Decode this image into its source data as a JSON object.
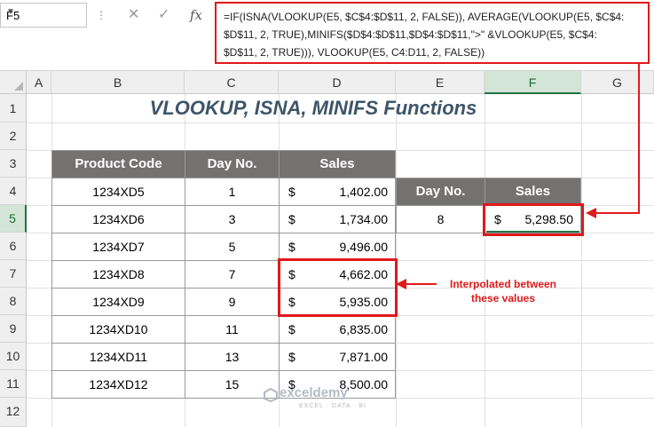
{
  "formula_bar": {
    "name_box": "F5",
    "formula": "=IF(ISNA(VLOOKUP(E5, $C$4:$D$11, 2, FALSE)), AVERAGE(VLOOKUP(E5, $C$4:\n$D$11, 2, TRUE),MINIFS($D$4:$D$11,$D$4:$D$11,\">\" &VLOOKUP(E5, $C$4:\n$D$11, 2, TRUE))), VLOOKUP(E5, C4:D11, 2, FALSE))"
  },
  "columns": [
    "A",
    "B",
    "C",
    "D",
    "E",
    "F",
    "G"
  ],
  "rows": [
    "1",
    "2",
    "3",
    "4",
    "5",
    "6",
    "7",
    "8",
    "9",
    "10",
    "11",
    "12"
  ],
  "title": "VLOOKUP, ISNA, MINIFS Functions",
  "table": {
    "headers": [
      "Product Code",
      "Day No.",
      "Sales"
    ],
    "rows": [
      {
        "code": "1234XD5",
        "day": "1",
        "cur": "$",
        "sales": "1,402.00"
      },
      {
        "code": "1234XD6",
        "day": "3",
        "cur": "$",
        "sales": "1,734.00"
      },
      {
        "code": "1234XD7",
        "day": "5",
        "cur": "$",
        "sales": "9,496.00"
      },
      {
        "code": "1234XD8",
        "day": "7",
        "cur": "$",
        "sales": "4,662.00"
      },
      {
        "code": "1234XD9",
        "day": "9",
        "cur": "$",
        "sales": "5,935.00"
      },
      {
        "code": "1234XD10",
        "day": "11",
        "cur": "$",
        "sales": "6,835.00"
      },
      {
        "code": "1234XD11",
        "day": "13",
        "cur": "$",
        "sales": "7,871.00"
      },
      {
        "code": "1234XD12",
        "day": "15",
        "cur": "$",
        "sales": "8,500.00"
      }
    ]
  },
  "lookup": {
    "day_header": "Day No.",
    "sales_header": "Sales",
    "day_value": "8",
    "cur": "$",
    "sales_value": "5,298.50"
  },
  "annotation": "Interpolated between these values",
  "watermark": {
    "name": "exceldemy",
    "sub": "EXCEL · DATA · BI"
  },
  "colors": {
    "header_fill": "#747171",
    "highlight": "#e0191b",
    "selection": "#217346"
  }
}
